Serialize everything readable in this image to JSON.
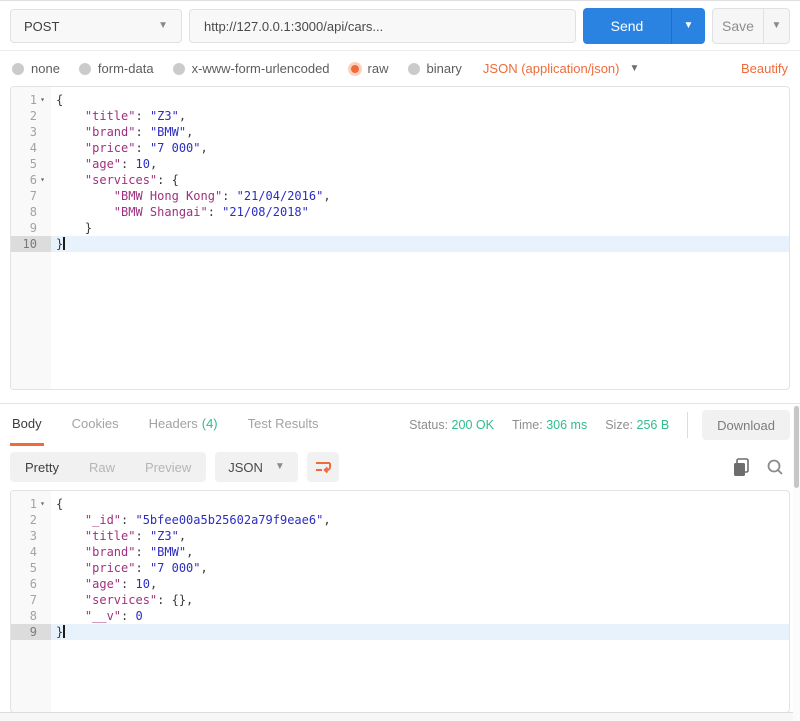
{
  "colors": {
    "accent_orange": "#f06b3c",
    "accent_blue": "#2a83e0",
    "accent_green": "#2ebd8b",
    "syntax": {
      "key": "#a0307f",
      "str": "#2c2dc3",
      "num": "#2c2dc3",
      "punc": "#3a3a3a",
      "plain": "#3a3a3a"
    }
  },
  "request_bar": {
    "method": "POST",
    "url": "http://127.0.0.1:3000/api/cars...",
    "send_label": "Send",
    "save_label": "Save"
  },
  "body_type_row": {
    "options": [
      {
        "label": "none",
        "selected": false
      },
      {
        "label": "form-data",
        "selected": false
      },
      {
        "label": "x-www-form-urlencoded",
        "selected": false
      },
      {
        "label": "raw",
        "selected": true
      },
      {
        "label": "binary",
        "selected": false
      }
    ],
    "content_type": "JSON (application/json)",
    "beautify_label": "Beautify"
  },
  "request_editor": {
    "lines": [
      {
        "n": 1,
        "fold": true,
        "active": false,
        "seg": [
          [
            "punc",
            "{"
          ]
        ]
      },
      {
        "n": 2,
        "fold": false,
        "active": false,
        "seg": [
          [
            "plain",
            "    "
          ],
          [
            "key",
            "\"title\""
          ],
          [
            "punc",
            ": "
          ],
          [
            "str",
            "\"Z3\""
          ],
          [
            "punc",
            ","
          ]
        ]
      },
      {
        "n": 3,
        "fold": false,
        "active": false,
        "seg": [
          [
            "plain",
            "    "
          ],
          [
            "key",
            "\"brand\""
          ],
          [
            "punc",
            ": "
          ],
          [
            "str",
            "\"BMW\""
          ],
          [
            "punc",
            ","
          ]
        ]
      },
      {
        "n": 4,
        "fold": false,
        "active": false,
        "seg": [
          [
            "plain",
            "    "
          ],
          [
            "key",
            "\"price\""
          ],
          [
            "punc",
            ": "
          ],
          [
            "str",
            "\"7 000\""
          ],
          [
            "punc",
            ","
          ]
        ]
      },
      {
        "n": 5,
        "fold": false,
        "active": false,
        "seg": [
          [
            "plain",
            "    "
          ],
          [
            "key",
            "\"age\""
          ],
          [
            "punc",
            ": "
          ],
          [
            "num",
            "10"
          ],
          [
            "punc",
            ","
          ]
        ]
      },
      {
        "n": 6,
        "fold": true,
        "active": false,
        "seg": [
          [
            "plain",
            "    "
          ],
          [
            "key",
            "\"services\""
          ],
          [
            "punc",
            ": {"
          ]
        ]
      },
      {
        "n": 7,
        "fold": false,
        "active": false,
        "seg": [
          [
            "plain",
            "        "
          ],
          [
            "key",
            "\"BMW Hong Kong\""
          ],
          [
            "punc",
            ": "
          ],
          [
            "str",
            "\"21/04/2016\""
          ],
          [
            "punc",
            ","
          ]
        ]
      },
      {
        "n": 8,
        "fold": false,
        "active": false,
        "seg": [
          [
            "plain",
            "        "
          ],
          [
            "key",
            "\"BMW Shangai\""
          ],
          [
            "punc",
            ": "
          ],
          [
            "str",
            "\"21/08/2018\""
          ]
        ]
      },
      {
        "n": 9,
        "fold": false,
        "active": false,
        "seg": [
          [
            "plain",
            "    "
          ],
          [
            "punc",
            "}"
          ]
        ]
      },
      {
        "n": 10,
        "fold": false,
        "active": true,
        "cursor": true,
        "seg": [
          [
            "punc",
            "}"
          ]
        ]
      }
    ]
  },
  "response_meta": {
    "tabs": [
      {
        "label": "Body",
        "active": true
      },
      {
        "label": "Cookies",
        "active": false
      },
      {
        "label": "Headers",
        "count": "(4)",
        "active": false
      },
      {
        "label": "Test Results",
        "active": false
      }
    ],
    "status_label": "Status:",
    "status_value": "200 OK",
    "time_label": "Time:",
    "time_value": "306 ms",
    "size_label": "Size:",
    "size_value": "256 B",
    "download_label": "Download"
  },
  "response_toolbar": {
    "views": [
      {
        "label": "Pretty",
        "active": true
      },
      {
        "label": "Raw",
        "active": false
      },
      {
        "label": "Preview",
        "active": false
      }
    ],
    "format": "JSON"
  },
  "response_editor": {
    "lines": [
      {
        "n": 1,
        "fold": true,
        "active": false,
        "seg": [
          [
            "punc",
            "{"
          ]
        ]
      },
      {
        "n": 2,
        "fold": false,
        "active": false,
        "seg": [
          [
            "plain",
            "    "
          ],
          [
            "key",
            "\"_id\""
          ],
          [
            "punc",
            ": "
          ],
          [
            "str",
            "\"5bfee00a5b25602a79f9eae6\""
          ],
          [
            "punc",
            ","
          ]
        ]
      },
      {
        "n": 3,
        "fold": false,
        "active": false,
        "seg": [
          [
            "plain",
            "    "
          ],
          [
            "key",
            "\"title\""
          ],
          [
            "punc",
            ": "
          ],
          [
            "str",
            "\"Z3\""
          ],
          [
            "punc",
            ","
          ]
        ]
      },
      {
        "n": 4,
        "fold": false,
        "active": false,
        "seg": [
          [
            "plain",
            "    "
          ],
          [
            "key",
            "\"brand\""
          ],
          [
            "punc",
            ": "
          ],
          [
            "str",
            "\"BMW\""
          ],
          [
            "punc",
            ","
          ]
        ]
      },
      {
        "n": 5,
        "fold": false,
        "active": false,
        "seg": [
          [
            "plain",
            "    "
          ],
          [
            "key",
            "\"price\""
          ],
          [
            "punc",
            ": "
          ],
          [
            "str",
            "\"7 000\""
          ],
          [
            "punc",
            ","
          ]
        ]
      },
      {
        "n": 6,
        "fold": false,
        "active": false,
        "seg": [
          [
            "plain",
            "    "
          ],
          [
            "key",
            "\"age\""
          ],
          [
            "punc",
            ": "
          ],
          [
            "num",
            "10"
          ],
          [
            "punc",
            ","
          ]
        ]
      },
      {
        "n": 7,
        "fold": false,
        "active": false,
        "seg": [
          [
            "plain",
            "    "
          ],
          [
            "key",
            "\"services\""
          ],
          [
            "punc",
            ": {},"
          ]
        ]
      },
      {
        "n": 8,
        "fold": false,
        "active": false,
        "seg": [
          [
            "plain",
            "    "
          ],
          [
            "key",
            "\"__v\""
          ],
          [
            "punc",
            ": "
          ],
          [
            "num",
            "0"
          ]
        ]
      },
      {
        "n": 9,
        "fold": false,
        "active": true,
        "cursor": true,
        "seg": [
          [
            "punc",
            "}"
          ]
        ]
      }
    ]
  }
}
